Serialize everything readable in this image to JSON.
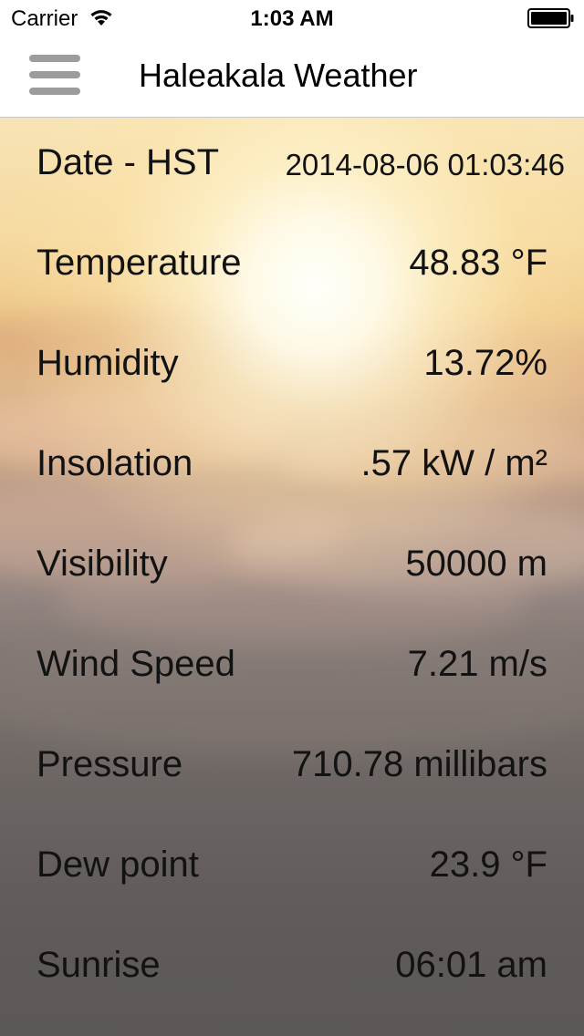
{
  "status_bar": {
    "carrier": "Carrier",
    "time": "1:03 AM",
    "wifi_icon": "wifi-icon",
    "battery_icon": "battery-icon"
  },
  "nav_bar": {
    "menu_icon": "hamburger-menu-icon",
    "title": "Haleakala Weather"
  },
  "rows": [
    {
      "label": "Date - HST",
      "value": "2014-08-06 01:03:46"
    },
    {
      "label": "Temperature",
      "value": "48.83 °F"
    },
    {
      "label": "Humidity",
      "value": "13.72%"
    },
    {
      "label": "Insolation",
      "value": ".57 kW / m²"
    },
    {
      "label": "Visibility",
      "value": "50000 m"
    },
    {
      "label": "Wind Speed",
      "value": "7.21 m/s"
    },
    {
      "label": "Pressure",
      "value": "710.78 millibars"
    },
    {
      "label": "Dew point",
      "value": "23.9 °F"
    },
    {
      "label": "Sunrise",
      "value": "06:01 am"
    }
  ],
  "colors": {
    "bar_background": "#ffffff",
    "text": "#121212",
    "menu_icon": "#9c9c9c",
    "separator": "#c8c7cc"
  }
}
